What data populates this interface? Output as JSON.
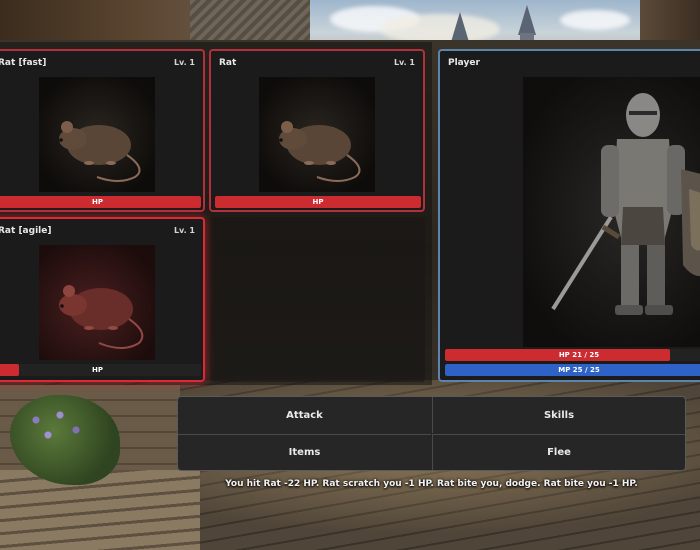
{
  "enemies": [
    {
      "name": "Rat [fast]",
      "level": "Lv. 1",
      "hp_label": "HP",
      "hp_fraction": 1.0,
      "state": "normal"
    },
    {
      "name": "Rat",
      "level": "Lv. 1",
      "hp_label": "HP",
      "hp_fraction": 1.0,
      "state": "normal"
    },
    {
      "name": "Rat [agile]",
      "level": "Lv. 1",
      "hp_label": "HP",
      "hp_fraction": 0.12,
      "state": "targeted"
    }
  ],
  "player": {
    "name": "Player",
    "hp_text": "HP 21 / 25",
    "hp_fraction": 0.84,
    "mp_text": "MP 25 / 25",
    "mp_fraction": 1.0
  },
  "actions": {
    "attack": "Attack",
    "skills": "Skills",
    "items": "Items",
    "flee": "Flee"
  },
  "combat_log": "You hit Rat -22 HP. Rat scratch you -1 HP. Rat bite you, dodge. Rat bite you -1 HP.",
  "colors": {
    "hp_bar": "#cc2b30",
    "mp_bar": "#2f62c7",
    "enemy_border": "#b2303a",
    "player_border": "#5d84ad"
  }
}
